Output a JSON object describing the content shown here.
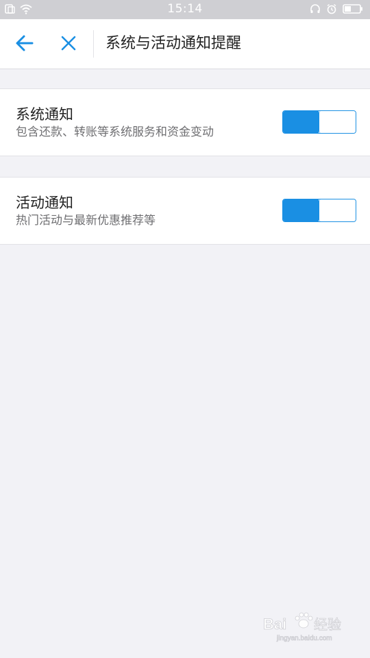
{
  "status_bar": {
    "time": "15:14",
    "icons": [
      "sim-icon",
      "wifi-icon",
      "headset-icon",
      "alarm-icon",
      "battery-icon"
    ]
  },
  "header": {
    "back_icon": "arrow-left-icon",
    "close_icon": "close-icon",
    "title": "系统与活动通知提醒"
  },
  "settings": [
    {
      "title": "系统通知",
      "description": "包含还款、转账等系统服务和资金变动",
      "enabled": true
    },
    {
      "title": "活动通知",
      "description": "热门活动与最新优惠推荐等",
      "enabled": true
    }
  ],
  "colors": {
    "accent": "#1a8fe3",
    "background": "#f2f2f6",
    "status_bar": "#cfcfd3"
  }
}
